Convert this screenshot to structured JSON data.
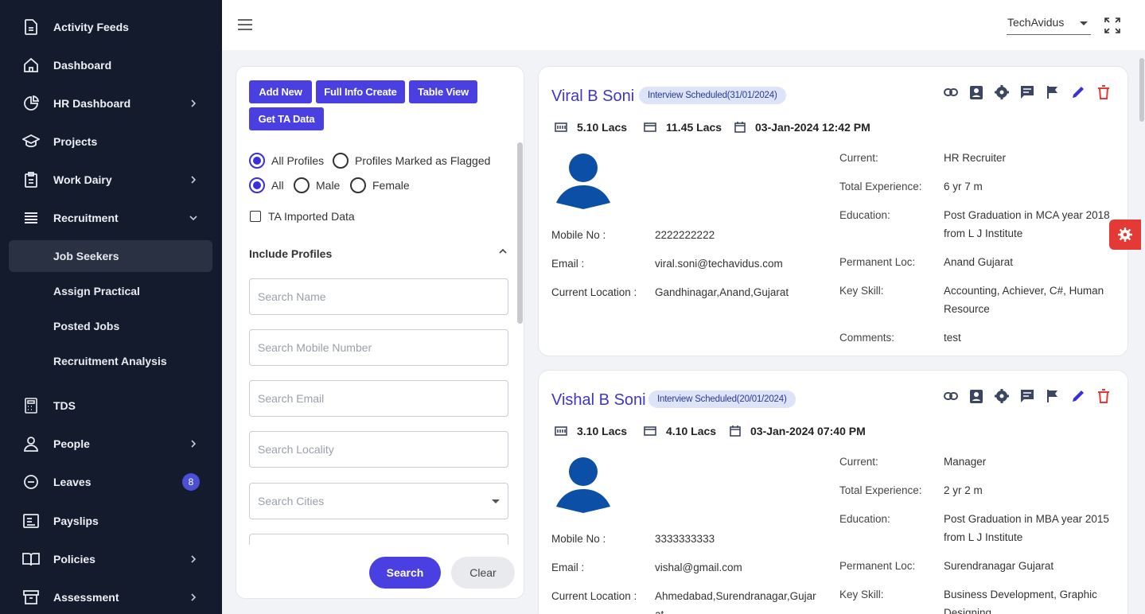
{
  "sidebar": {
    "items": [
      {
        "label": "Activity Feeds",
        "icon": "document-icon"
      },
      {
        "label": "Dashboard",
        "icon": "home-icon"
      },
      {
        "label": "HR Dashboard",
        "icon": "pie-chart-icon"
      },
      {
        "label": "Projects",
        "icon": "graduation-cap-icon"
      },
      {
        "label": "Work Dairy",
        "icon": "clipboard-icon"
      },
      {
        "label": "Recruitment",
        "icon": "list-icon"
      },
      {
        "label": "TDS",
        "icon": "calculator-icon"
      },
      {
        "label": "People",
        "icon": "people-icon"
      },
      {
        "label": "Leaves",
        "icon": "minus-circle-icon",
        "badge": "8"
      },
      {
        "label": "Payslips",
        "icon": "payslip-icon"
      },
      {
        "label": "Policies",
        "icon": "book-icon"
      },
      {
        "label": "Assessment",
        "icon": "archive-icon"
      }
    ],
    "recruitment_sub": [
      "Job Seekers",
      "Assign Practical",
      "Posted Jobs",
      "Recruitment Analysis"
    ],
    "active_sub": "Job Seekers"
  },
  "topbar": {
    "company": "TechAvidus"
  },
  "filters": {
    "buttons": {
      "add_new": "Add New",
      "full_info_create": "Full Info Create",
      "table_view": "Table View",
      "get_ta_data": "Get TA Data"
    },
    "profile_radios": {
      "all_profiles": "All Profiles",
      "flagged": "Profiles Marked as Flagged",
      "selected": "All Profiles"
    },
    "gender_radios": {
      "all": "All",
      "male": "Male",
      "female": "Female",
      "selected": "All"
    },
    "ta_imported": "TA Imported Data",
    "include_profiles": "Include Profiles",
    "placeholders": {
      "name": "Search Name",
      "mobile": "Search Mobile Number",
      "email": "Search Email",
      "locality": "Search Locality",
      "cities": "Search Cities"
    },
    "search_label": "Search",
    "clear_label": "Clear"
  },
  "labels": {
    "mobile": "Mobile No :",
    "email": "Email :",
    "current_location": "Current Location :",
    "current": "Current:",
    "total_experience": "Total Experience:",
    "education": "Education:",
    "permanent_loc": "Permanent Loc:",
    "key_skill": "Key Skill:",
    "comments": "Comments:"
  },
  "candidates": [
    {
      "name": "Viral B Soni",
      "status": "Interview Scheduled(31/01/2024)",
      "current_ctc": "5.10 Lacs",
      "expected_ctc": "11.45 Lacs",
      "date": "03-Jan-2024 12:42 PM",
      "mobile": "2222222222",
      "email": "viral.soni@techavidus.com",
      "location": "Gandhinagar,Anand,Gujarat",
      "current": "HR Recruiter",
      "experience": "6 yr 7 m",
      "education": "Post Graduation in MCA year 2018 from L J Institute",
      "permanent_loc": "Anand Gujarat",
      "key_skill": "Accounting, Achiever, C#, Human Resource",
      "comments": "test"
    },
    {
      "name": "Vishal B Soni",
      "status": "Interview Scheduled(20/01/2024)",
      "current_ctc": "3.10 Lacs",
      "expected_ctc": "4.10 Lacs",
      "date": "03-Jan-2024 07:40 PM",
      "mobile": "3333333333",
      "email": "vishal@gmail.com",
      "location": "Ahmedabad,Surendranagar,Gujarat",
      "current": "Manager",
      "experience": "2 yr 2 m",
      "education": "Post Graduation in MBA year 2015 from L J Institute",
      "permanent_loc": "Surendranagar Gujarat",
      "key_skill": "Business Development, Graphic Designing"
    }
  ],
  "colors": {
    "sidebar_bg": "#141b2d",
    "primary": "#4a3fe0",
    "name": "#3e35c9",
    "delete": "#e53935"
  }
}
